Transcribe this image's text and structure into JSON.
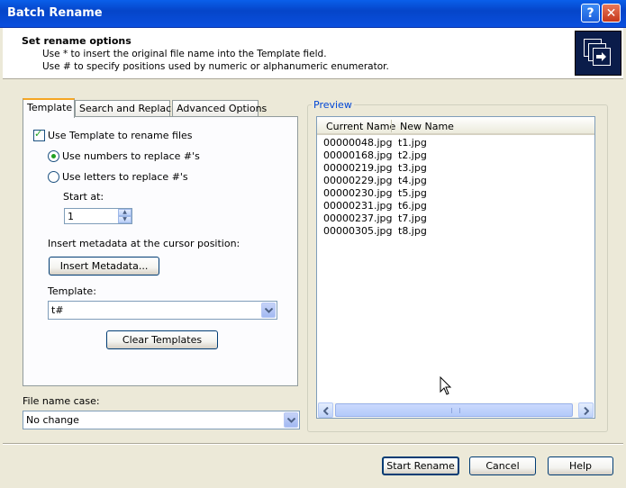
{
  "window": {
    "title": "Batch Rename"
  },
  "header": {
    "title": "Set rename options",
    "line1": "Use * to insert the original file name into the Template field.",
    "line2": "Use # to specify positions used by numeric or alphanumeric enumerator."
  },
  "tabs": [
    {
      "label": "Template",
      "active": true
    },
    {
      "label": "Search and Replace",
      "active": false
    },
    {
      "label": "Advanced Options",
      "active": false
    }
  ],
  "template_tab": {
    "use_template_label": "Use Template to rename files",
    "use_template_checked": true,
    "radio_numbers_label": "Use numbers to replace #'s",
    "radio_letters_label": "Use letters to replace #'s",
    "selected_radio": "numbers",
    "start_at_label": "Start at:",
    "start_at_value": "1",
    "metadata_label": "Insert metadata at the cursor position:",
    "insert_metadata_button": "Insert Metadata...",
    "template_label": "Template:",
    "template_value": "t#",
    "clear_templates_button": "Clear Templates"
  },
  "file_name_case": {
    "label": "File name case:",
    "value": "No change"
  },
  "preview": {
    "label": "Preview",
    "columns": [
      "Current Name",
      "New Name"
    ],
    "rows": [
      [
        "00000048.jpg",
        "t1.jpg"
      ],
      [
        "00000168.jpg",
        "t2.jpg"
      ],
      [
        "00000219.jpg",
        "t3.jpg"
      ],
      [
        "00000229.jpg",
        "t4.jpg"
      ],
      [
        "00000230.jpg",
        "t5.jpg"
      ],
      [
        "00000231.jpg",
        "t6.jpg"
      ],
      [
        "00000237.jpg",
        "t7.jpg"
      ],
      [
        "00000305.jpg",
        "t8.jpg"
      ]
    ]
  },
  "buttons": {
    "start": "Start Rename",
    "cancel": "Cancel",
    "help": "Help"
  },
  "titlebar_buttons": {
    "help": "?",
    "close": "✕"
  },
  "colors": {
    "title_bar": "#0A5FEA",
    "accent_tab": "#F5A623",
    "group_label": "#0046D5",
    "check_mark": "#21A121"
  }
}
